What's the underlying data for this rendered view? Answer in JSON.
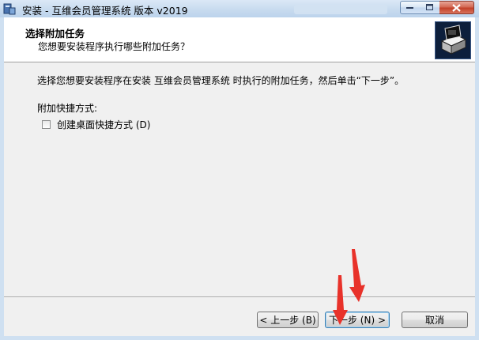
{
  "window": {
    "title": "安装 - 互维会员管理系统 版本 v2019",
    "minimize_label": "—",
    "maximize_label": "☐",
    "close_label": "✕"
  },
  "header": {
    "title": "选择附加任务",
    "subtitle": "您想要安装程序执行哪些附加任务？"
  },
  "body": {
    "intro": "选择您想要安装程序在安装 互维会员管理系统 时执行的附加任务，然后单击“下一步”。",
    "group_label": "附加快捷方式:",
    "checkbox_label": "创建桌面快捷方式 (D)",
    "checkbox_checked": false
  },
  "footer": {
    "back_label": "< 上一步 (B)",
    "next_label": "下一步 (N) >",
    "cancel_label": "取消"
  },
  "colors": {
    "annotation_arrow": "#e8322a"
  }
}
